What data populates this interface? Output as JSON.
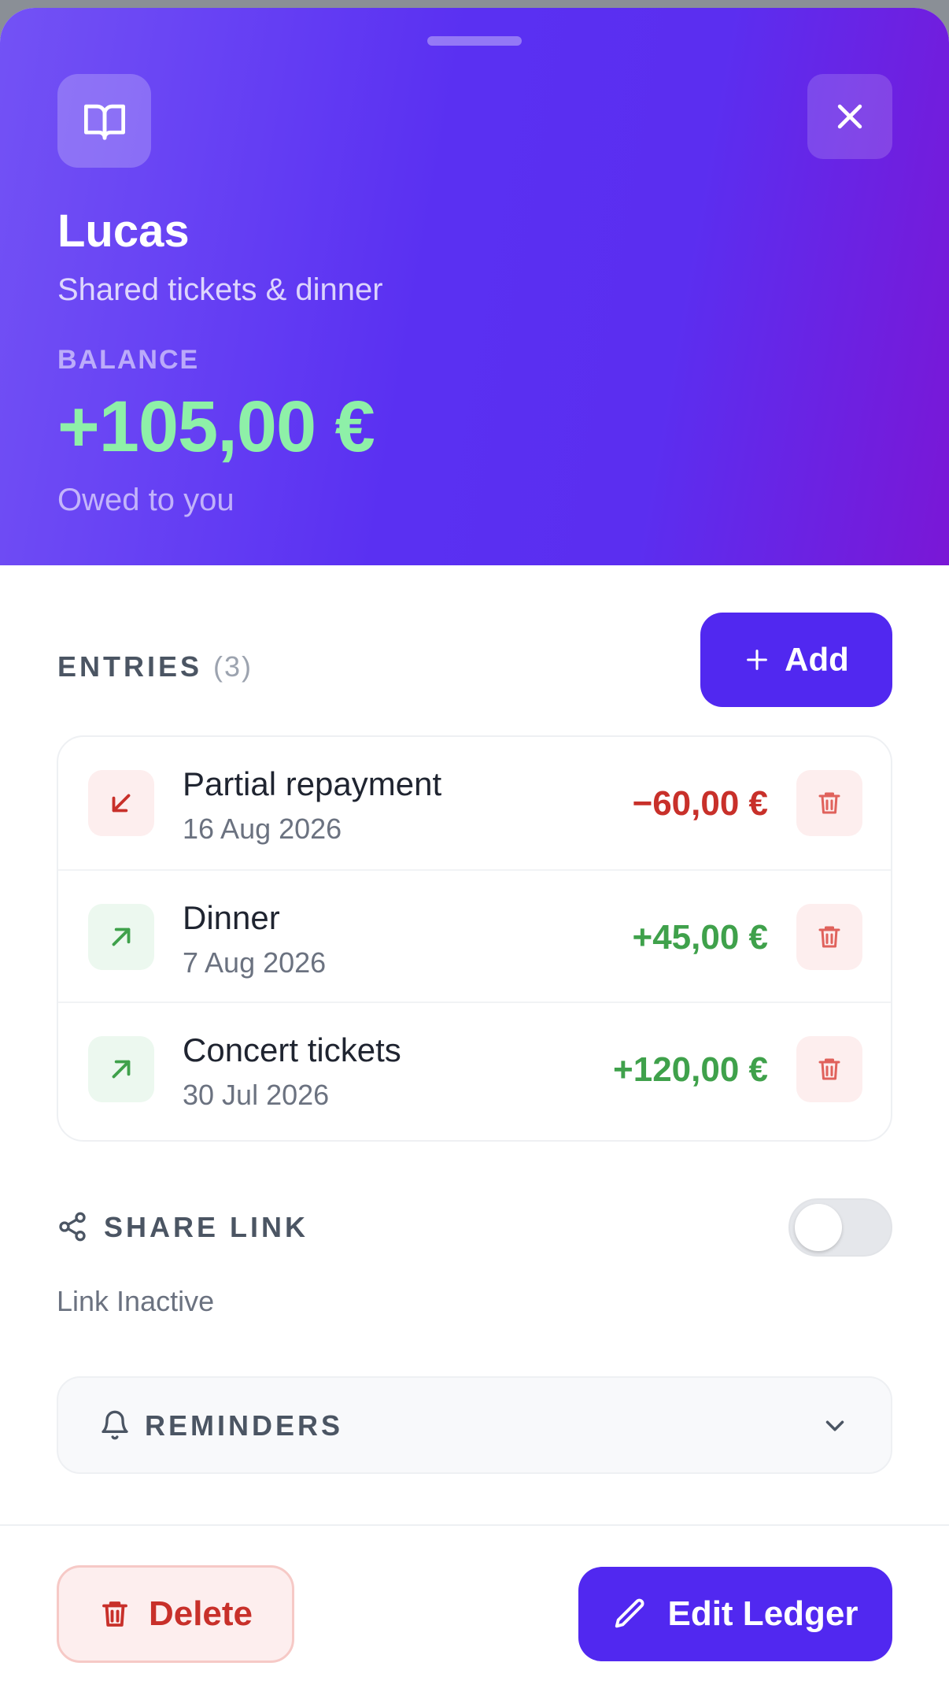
{
  "ledger": {
    "name": "Lucas",
    "description": "Shared tickets & dinner",
    "balance_label": "BALANCE",
    "balance": "+105,00 €",
    "balance_status": "Owed to you"
  },
  "entries": {
    "heading": "ENTRIES",
    "count": "(3)",
    "add_label": "Add",
    "items": [
      {
        "title": "Partial repayment",
        "date": "16 Aug 2026",
        "amount": "−60,00 €",
        "direction": "out"
      },
      {
        "title": "Dinner",
        "date": "7 Aug 2026",
        "amount": "+45,00 €",
        "direction": "in"
      },
      {
        "title": "Concert tickets",
        "date": "30 Jul 2026",
        "amount": "+120,00 €",
        "direction": "in"
      }
    ]
  },
  "share": {
    "label": "SHARE LINK",
    "status": "Link Inactive",
    "enabled": false
  },
  "reminders": {
    "label": "REMINDERS"
  },
  "footer": {
    "delete_label": "Delete",
    "edit_label": "Edit Ledger"
  },
  "colors": {
    "accent": "#5128f0",
    "positive": "#3fa14b",
    "negative": "#c8302a",
    "balance_positive": "#8ef0a8"
  }
}
